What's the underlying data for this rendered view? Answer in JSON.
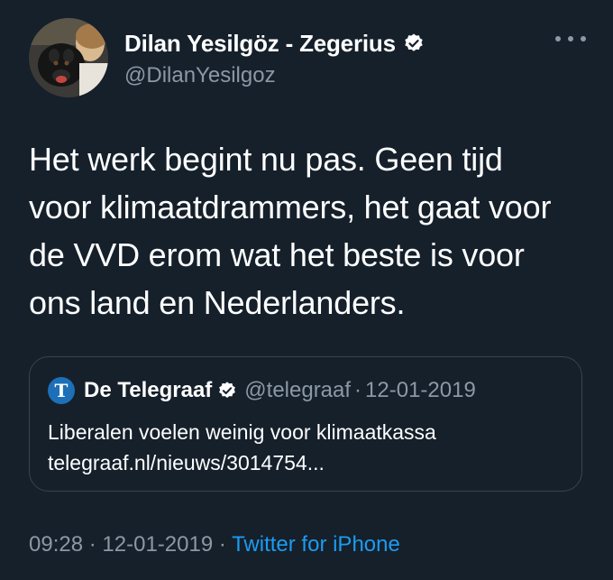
{
  "author": {
    "name": "Dilan Yesilgöz - Zegerius",
    "handle": "@DilanYesilgoz",
    "verified": true,
    "avatar_icon": "profile-photo-with-dog"
  },
  "menu": {
    "icon": "more-horizontal-icon"
  },
  "tweet": {
    "text": "Het werk begint nu pas. Geen tijd\nvoor klimaatdrammers, het gaat voor\nde VVD erom wat het beste is voor\nons land en Nederlanders."
  },
  "quoted_tweet": {
    "logo_letter": "T",
    "name": "De Telegraaf",
    "verified": true,
    "handle": "@telegraaf",
    "separator": "·",
    "date": "12-01-2019",
    "line1": "Liberalen voelen weinig voor klimaatkassa",
    "line2": "telegraaf.nl/nieuws/3014754..."
  },
  "meta": {
    "time": "09:28",
    "separator": "·",
    "date": "12-01-2019",
    "source": "Twitter for iPhone"
  },
  "colors": {
    "background": "#15202b",
    "text": "#ffffff",
    "secondary_text": "#8b98a5",
    "accent": "#1d9bf0",
    "border": "#38444d"
  }
}
